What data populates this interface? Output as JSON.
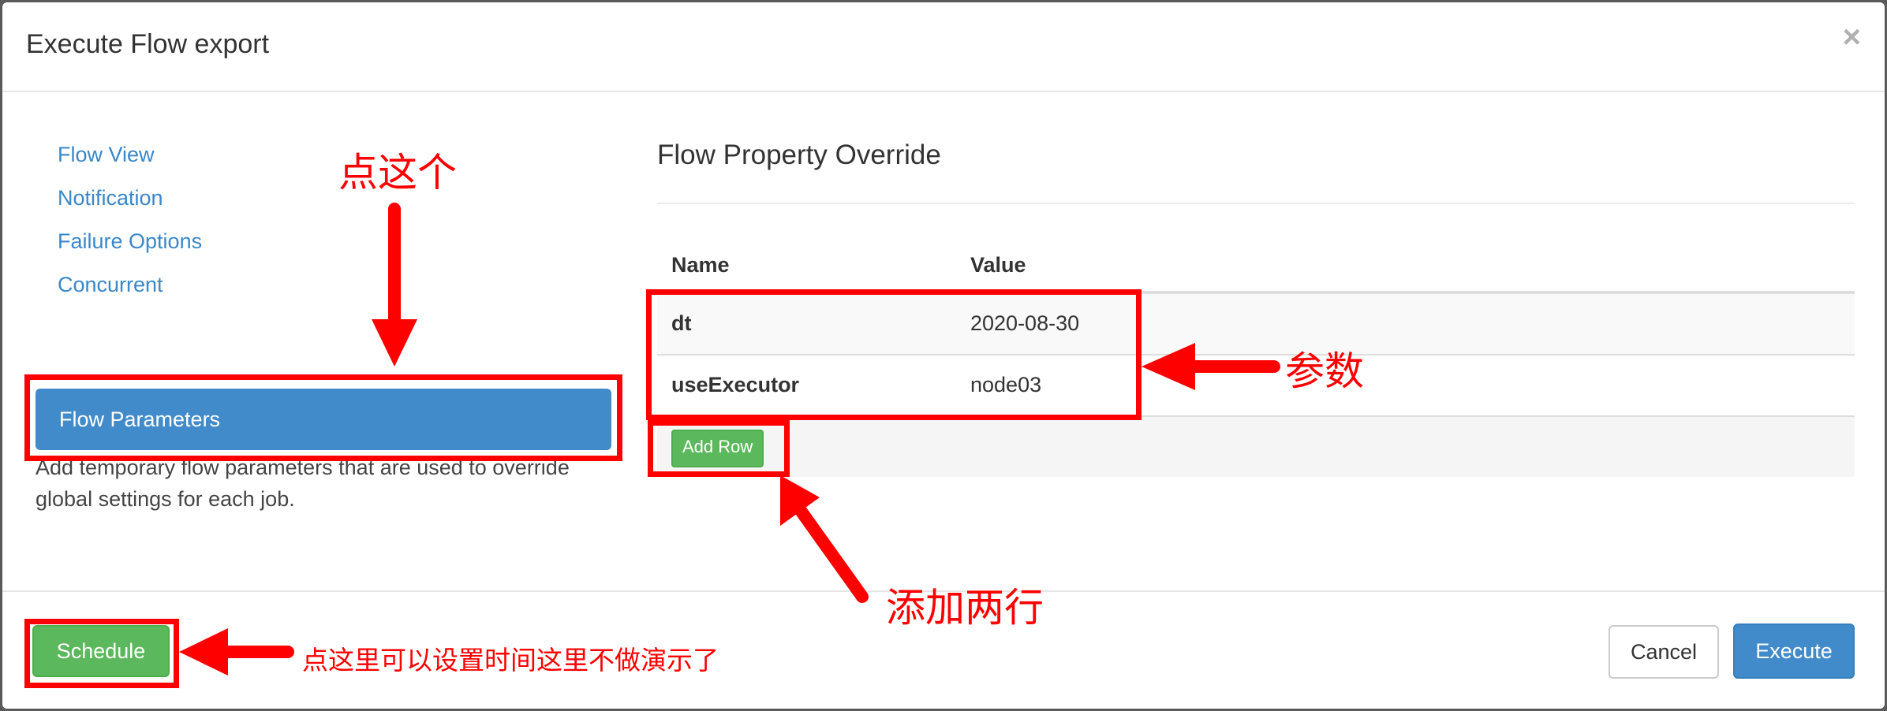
{
  "dialog": {
    "title": "Execute Flow export",
    "close_glyph": "×"
  },
  "sidebar": {
    "items": [
      {
        "label": "Flow View"
      },
      {
        "label": "Notification"
      },
      {
        "label": "Failure Options"
      },
      {
        "label": "Concurrent"
      },
      {
        "label": "Flow Parameters",
        "active": true
      }
    ],
    "help_text": "Add temporary flow parameters that are used to override global settings for each job."
  },
  "main": {
    "section_title": "Flow Property Override",
    "table": {
      "headers": [
        "Name",
        "Value"
      ],
      "rows": [
        {
          "name": "dt",
          "value": "2020-08-30"
        },
        {
          "name": "useExecutor",
          "value": "node03"
        }
      ],
      "add_row_label": "Add Row"
    }
  },
  "footer": {
    "schedule_label": "Schedule",
    "cancel_label": "Cancel",
    "execute_label": "Execute"
  },
  "annotations": {
    "click_this": "点这个",
    "params": "参数",
    "add_two_rows": "添加两行",
    "schedule_note": "点这里可以设置时间这里不做演示了"
  },
  "colors": {
    "primary": "#428bca",
    "success": "#5cb85c",
    "annotation": "#ff0000",
    "link": "#3a87c8"
  }
}
